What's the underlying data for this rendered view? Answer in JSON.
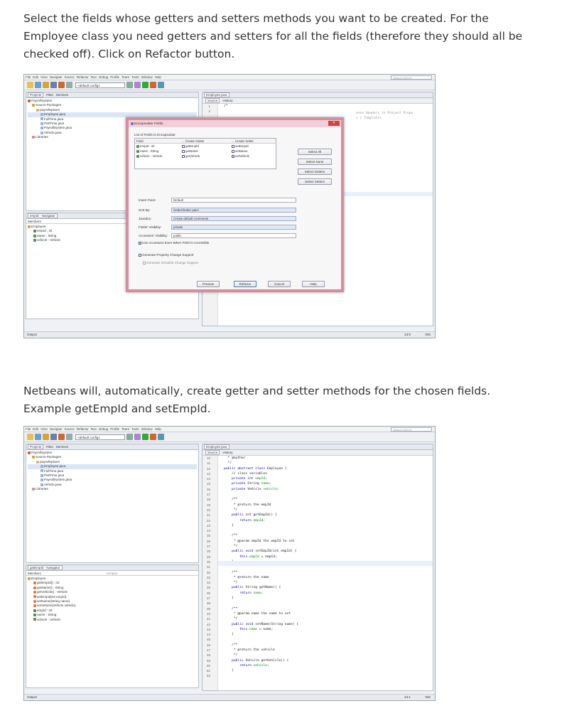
{
  "para1": "Select the fields whose getters and setters methods you want to be created. For the Employee class you need getters and setters for all the fields (therefore they should all be checked off). Click on Refactor button.",
  "para2": "Netbeans will, automatically, create getter and setter methods for the chosen fields. Example getEmpId and setEmpId.",
  "ide": {
    "menu": [
      "File",
      "Edit",
      "View",
      "Navigate",
      "Source",
      "Refactor",
      "Run",
      "Debug",
      "Profile",
      "Team",
      "Tools",
      "Window",
      "Help"
    ],
    "search_placeholder": "Search (Ctrl+I)",
    "config": "<default config>",
    "project_tabs": [
      "Projects",
      "Files",
      "Services"
    ],
    "tree": [
      "PayrollSystem",
      "Source Packages",
      "payrollsystem",
      "Employee.java",
      "FullTime.java",
      "PartTime.java",
      "PayrollSystem.java",
      "Vehicle.java",
      "Libraries"
    ],
    "editor_tab": "Employee.java",
    "source_label": "Source",
    "history_label": "History",
    "output_label": "Output"
  },
  "shot1": {
    "navigator_title": "empId - Navigator",
    "members_label": "Members",
    "members": [
      "Employee",
      "empId : int",
      "name : String",
      "vehicle : Vehicle"
    ],
    "code_lines": [
      "1",
      "2"
    ],
    "code_text": [
      "/*"
    ],
    "code_right": [
      "ense Headers in Project Prope",
      "s | Templates"
    ],
    "caret": "13:9",
    "ins": "INS"
  },
  "dialog": {
    "title": "Encapsulate Fields",
    "list_label": "List of Fields to Encapsulate:",
    "col_field": "Field",
    "col_getter": "... Create Getter",
    "col_setter": "... Create Setter",
    "rows": [
      {
        "field": "empId : int",
        "getter": "getEmpId",
        "setter": "setEmpId"
      },
      {
        "field": "name : String",
        "getter": "getName",
        "setter": "setName"
      },
      {
        "field": "vehicle : Vehicle",
        "getter": "getVehicle",
        "setter": "setVehicle"
      }
    ],
    "select_all": "Select All",
    "select_none": "Select None",
    "select_getters": "Select Getters",
    "select_setters": "Select Setters",
    "insert_point_label": "Insert Point:",
    "insert_point": "Default",
    "sort_label": "Sort By:",
    "sort": "Getter/Setter pairs",
    "javadoc_label": "Javadoc:",
    "javadoc": "Create default comments",
    "field_vis_label": "Fields' Visibility:",
    "field_vis": "private",
    "acc_vis_label": "Accessors' Visibility:",
    "acc_vis": "public",
    "use_accessors": "Use Accessors Even When Field Is Accessible",
    "gen_prop": "Generate Property Change Support",
    "gen_veto": "Generate Vetoable Change Support",
    "preview": "Preview",
    "refactor": "Refactor",
    "cancel": "Cancel",
    "help": "Help"
  },
  "shot2": {
    "navigator_title": "getEmpId - Navigator",
    "members_label": "Members",
    "empty_label": "<empty>",
    "members": [
      "Employee",
      "getEmpId() : int",
      "getName() : String",
      "getVehicle() : Vehicle",
      "setEmpId(int empId)",
      "setName(String name)",
      "setVehicle(Vehicle vehicle)",
      "empId : int",
      "name : String",
      "vehicle : Vehicle"
    ],
    "line_numbers": [
      "10",
      "11",
      "12",
      "13",
      "14",
      "15",
      "16",
      "17",
      "18",
      "19",
      "20",
      "21",
      "22",
      "23",
      "24",
      "25",
      "26",
      "27",
      "28",
      "29",
      "30",
      "31",
      "32",
      "33",
      "34",
      "35",
      "36",
      "37",
      "38",
      "39",
      "40",
      "41",
      "42",
      "43",
      "44",
      "45",
      "46",
      "47",
      "48",
      "49",
      "50",
      "51",
      "52"
    ],
    "caret": "24:1",
    "ins": "INS"
  }
}
